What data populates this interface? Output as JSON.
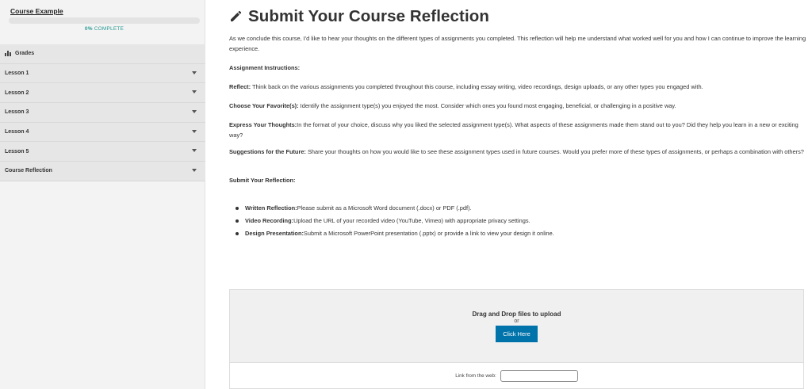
{
  "sidebar": {
    "course_title": "Course Example",
    "progress_percent": 0,
    "progress_value": "0%",
    "progress_label": "COMPLETE",
    "items": [
      {
        "label": "Grades",
        "icon": "bar-chart-icon"
      },
      {
        "label": "Lesson 1",
        "icon": "caret-down-icon"
      },
      {
        "label": "Lesson 2",
        "icon": "caret-down-icon"
      },
      {
        "label": "Lesson 3",
        "icon": "caret-down-icon"
      },
      {
        "label": "Lesson 4",
        "icon": "caret-down-icon"
      },
      {
        "label": "Lesson 5",
        "icon": "caret-down-icon"
      },
      {
        "label": "Course Reflection",
        "icon": "caret-down-icon"
      }
    ]
  },
  "main": {
    "title": "Submit Your Course Reflection",
    "title_icon": "pencil-icon",
    "intro": "As we conclude this course, I'd like to hear your thoughts on the different types of assignments you completed. This reflection will help me understand what worked well for you and how I can continue to improve the learning experience.",
    "instructions_heading": "Assignment Instructions:",
    "reflect": {
      "label": "Reflect:",
      "text": " Think back on the various assignments you completed throughout this course, including essay writing, video recordings, design uploads, or any other types you engaged with."
    },
    "favorite": {
      "label": "Choose Your Favorite(s):",
      "text": " Identify the assignment type(s) you enjoyed the most. Consider which ones you found most engaging, beneficial, or challenging in a positive way."
    },
    "express": {
      "label": "Express Your Thoughts:",
      "text": "In the format of your choice, discuss why you liked the selected assignment type(s). What aspects of these assignments made them stand out to you? Did they help you learn in a new or exciting way?"
    },
    "suggestions": {
      "label": "Suggestions for the Future:",
      "text": " Share your thoughts on how you would like to see these assignment types used in future courses. Would you prefer more of these types of assignments, or perhaps a combination with others?"
    },
    "submit_heading": "Submit Your Reflection:",
    "bullets": [
      {
        "label": "Written Reflection:",
        "text": " Please submit as a Microsoft Word document (.docx) or PDF (.pdf)."
      },
      {
        "label": "Video Recording:",
        "text": " Upload the URL of your recorded video (YouTube, Vimeo) with appropriate privacy settings."
      },
      {
        "label": "Design Presentation:",
        "text": " Submit a Microsoft PowerPoint presentation (.pptx) or provide a link to view your design it online."
      }
    ]
  },
  "upload": {
    "drop_title": "Drag and Drop files to upload",
    "or_text": "or",
    "button_label": "Click Here",
    "link_label": "Link from the web:",
    "link_value": ""
  },
  "colors": {
    "accent": "#2a9b95",
    "button": "#0073aa",
    "sidebar_bg": "#f3f3f3",
    "nav_bg": "#e6e6e6"
  }
}
